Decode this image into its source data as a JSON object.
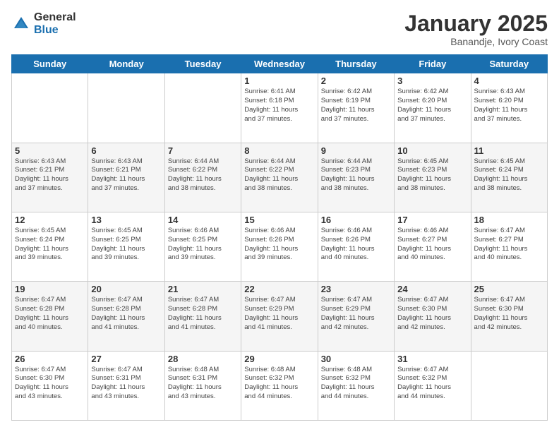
{
  "logo": {
    "general": "General",
    "blue": "Blue"
  },
  "header": {
    "month": "January 2025",
    "location": "Banandje, Ivory Coast"
  },
  "weekdays": [
    "Sunday",
    "Monday",
    "Tuesday",
    "Wednesday",
    "Thursday",
    "Friday",
    "Saturday"
  ],
  "weeks": [
    [
      {
        "day": "",
        "info": ""
      },
      {
        "day": "",
        "info": ""
      },
      {
        "day": "",
        "info": ""
      },
      {
        "day": "1",
        "info": "Sunrise: 6:41 AM\nSunset: 6:18 PM\nDaylight: 11 hours\nand 37 minutes."
      },
      {
        "day": "2",
        "info": "Sunrise: 6:42 AM\nSunset: 6:19 PM\nDaylight: 11 hours\nand 37 minutes."
      },
      {
        "day": "3",
        "info": "Sunrise: 6:42 AM\nSunset: 6:20 PM\nDaylight: 11 hours\nand 37 minutes."
      },
      {
        "day": "4",
        "info": "Sunrise: 6:43 AM\nSunset: 6:20 PM\nDaylight: 11 hours\nand 37 minutes."
      }
    ],
    [
      {
        "day": "5",
        "info": "Sunrise: 6:43 AM\nSunset: 6:21 PM\nDaylight: 11 hours\nand 37 minutes."
      },
      {
        "day": "6",
        "info": "Sunrise: 6:43 AM\nSunset: 6:21 PM\nDaylight: 11 hours\nand 37 minutes."
      },
      {
        "day": "7",
        "info": "Sunrise: 6:44 AM\nSunset: 6:22 PM\nDaylight: 11 hours\nand 38 minutes."
      },
      {
        "day": "8",
        "info": "Sunrise: 6:44 AM\nSunset: 6:22 PM\nDaylight: 11 hours\nand 38 minutes."
      },
      {
        "day": "9",
        "info": "Sunrise: 6:44 AM\nSunset: 6:23 PM\nDaylight: 11 hours\nand 38 minutes."
      },
      {
        "day": "10",
        "info": "Sunrise: 6:45 AM\nSunset: 6:23 PM\nDaylight: 11 hours\nand 38 minutes."
      },
      {
        "day": "11",
        "info": "Sunrise: 6:45 AM\nSunset: 6:24 PM\nDaylight: 11 hours\nand 38 minutes."
      }
    ],
    [
      {
        "day": "12",
        "info": "Sunrise: 6:45 AM\nSunset: 6:24 PM\nDaylight: 11 hours\nand 39 minutes."
      },
      {
        "day": "13",
        "info": "Sunrise: 6:45 AM\nSunset: 6:25 PM\nDaylight: 11 hours\nand 39 minutes."
      },
      {
        "day": "14",
        "info": "Sunrise: 6:46 AM\nSunset: 6:25 PM\nDaylight: 11 hours\nand 39 minutes."
      },
      {
        "day": "15",
        "info": "Sunrise: 6:46 AM\nSunset: 6:26 PM\nDaylight: 11 hours\nand 39 minutes."
      },
      {
        "day": "16",
        "info": "Sunrise: 6:46 AM\nSunset: 6:26 PM\nDaylight: 11 hours\nand 40 minutes."
      },
      {
        "day": "17",
        "info": "Sunrise: 6:46 AM\nSunset: 6:27 PM\nDaylight: 11 hours\nand 40 minutes."
      },
      {
        "day": "18",
        "info": "Sunrise: 6:47 AM\nSunset: 6:27 PM\nDaylight: 11 hours\nand 40 minutes."
      }
    ],
    [
      {
        "day": "19",
        "info": "Sunrise: 6:47 AM\nSunset: 6:28 PM\nDaylight: 11 hours\nand 40 minutes."
      },
      {
        "day": "20",
        "info": "Sunrise: 6:47 AM\nSunset: 6:28 PM\nDaylight: 11 hours\nand 41 minutes."
      },
      {
        "day": "21",
        "info": "Sunrise: 6:47 AM\nSunset: 6:28 PM\nDaylight: 11 hours\nand 41 minutes."
      },
      {
        "day": "22",
        "info": "Sunrise: 6:47 AM\nSunset: 6:29 PM\nDaylight: 11 hours\nand 41 minutes."
      },
      {
        "day": "23",
        "info": "Sunrise: 6:47 AM\nSunset: 6:29 PM\nDaylight: 11 hours\nand 42 minutes."
      },
      {
        "day": "24",
        "info": "Sunrise: 6:47 AM\nSunset: 6:30 PM\nDaylight: 11 hours\nand 42 minutes."
      },
      {
        "day": "25",
        "info": "Sunrise: 6:47 AM\nSunset: 6:30 PM\nDaylight: 11 hours\nand 42 minutes."
      }
    ],
    [
      {
        "day": "26",
        "info": "Sunrise: 6:47 AM\nSunset: 6:30 PM\nDaylight: 11 hours\nand 43 minutes."
      },
      {
        "day": "27",
        "info": "Sunrise: 6:47 AM\nSunset: 6:31 PM\nDaylight: 11 hours\nand 43 minutes."
      },
      {
        "day": "28",
        "info": "Sunrise: 6:48 AM\nSunset: 6:31 PM\nDaylight: 11 hours\nand 43 minutes."
      },
      {
        "day": "29",
        "info": "Sunrise: 6:48 AM\nSunset: 6:32 PM\nDaylight: 11 hours\nand 44 minutes."
      },
      {
        "day": "30",
        "info": "Sunrise: 6:48 AM\nSunset: 6:32 PM\nDaylight: 11 hours\nand 44 minutes."
      },
      {
        "day": "31",
        "info": "Sunrise: 6:47 AM\nSunset: 6:32 PM\nDaylight: 11 hours\nand 44 minutes."
      },
      {
        "day": "",
        "info": ""
      }
    ]
  ]
}
